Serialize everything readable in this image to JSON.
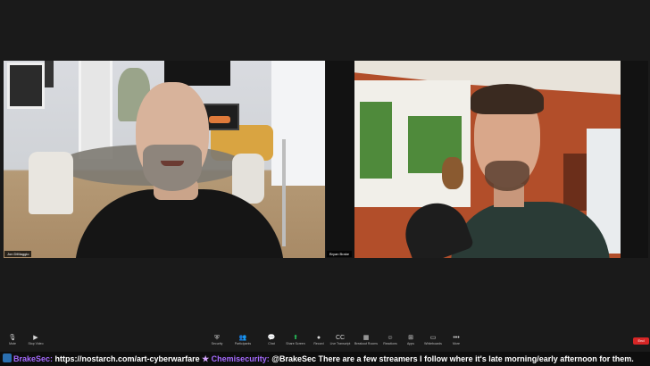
{
  "participants": [
    {
      "name": "Jon DiMaggio"
    },
    {
      "name": "Bryan Brake"
    }
  ],
  "toolbar": {
    "items": [
      {
        "icon": "microphone-icon",
        "glyph": "🎙",
        "label": "Mute"
      },
      {
        "icon": "camera-icon",
        "glyph": "▶",
        "label": "Stop Video"
      },
      {
        "icon": "shield-icon",
        "glyph": "⛨",
        "label": "Security"
      },
      {
        "icon": "participants-icon",
        "glyph": "👥",
        "label": "Participants"
      },
      {
        "icon": "chat-icon",
        "glyph": "💬",
        "label": "Chat"
      },
      {
        "icon": "share-screen-icon",
        "glyph": "⬆",
        "label": "Share Screen"
      },
      {
        "icon": "record-icon",
        "glyph": "●",
        "label": "Record"
      },
      {
        "icon": "transcript-icon",
        "glyph": "CC",
        "label": "Live Transcript"
      },
      {
        "icon": "breakout-rooms-icon",
        "glyph": "▦",
        "label": "Breakout Rooms"
      },
      {
        "icon": "reactions-icon",
        "glyph": "☺",
        "label": "Reactions"
      },
      {
        "icon": "apps-icon",
        "glyph": "⊞",
        "label": "Apps"
      },
      {
        "icon": "whiteboard-icon",
        "glyph": "▭",
        "label": "Whiteboards"
      },
      {
        "icon": "more-icon",
        "glyph": "•••",
        "label": "More"
      }
    ],
    "end_label": "End"
  },
  "ticker": {
    "user1": "BrakeSec:",
    "msg1": " https://nostarch.com/art-cyberwarfare ",
    "user2": "Chemisecurity:",
    "msg2": " @BrakeSec There are a few streamers I follow where it's late morning/early afternoon for them."
  },
  "colors": {
    "background": "#1a1a1a",
    "end_button": "#d62626",
    "chat_username": "#a66bff",
    "share_screen_icon": "#26c05a"
  }
}
